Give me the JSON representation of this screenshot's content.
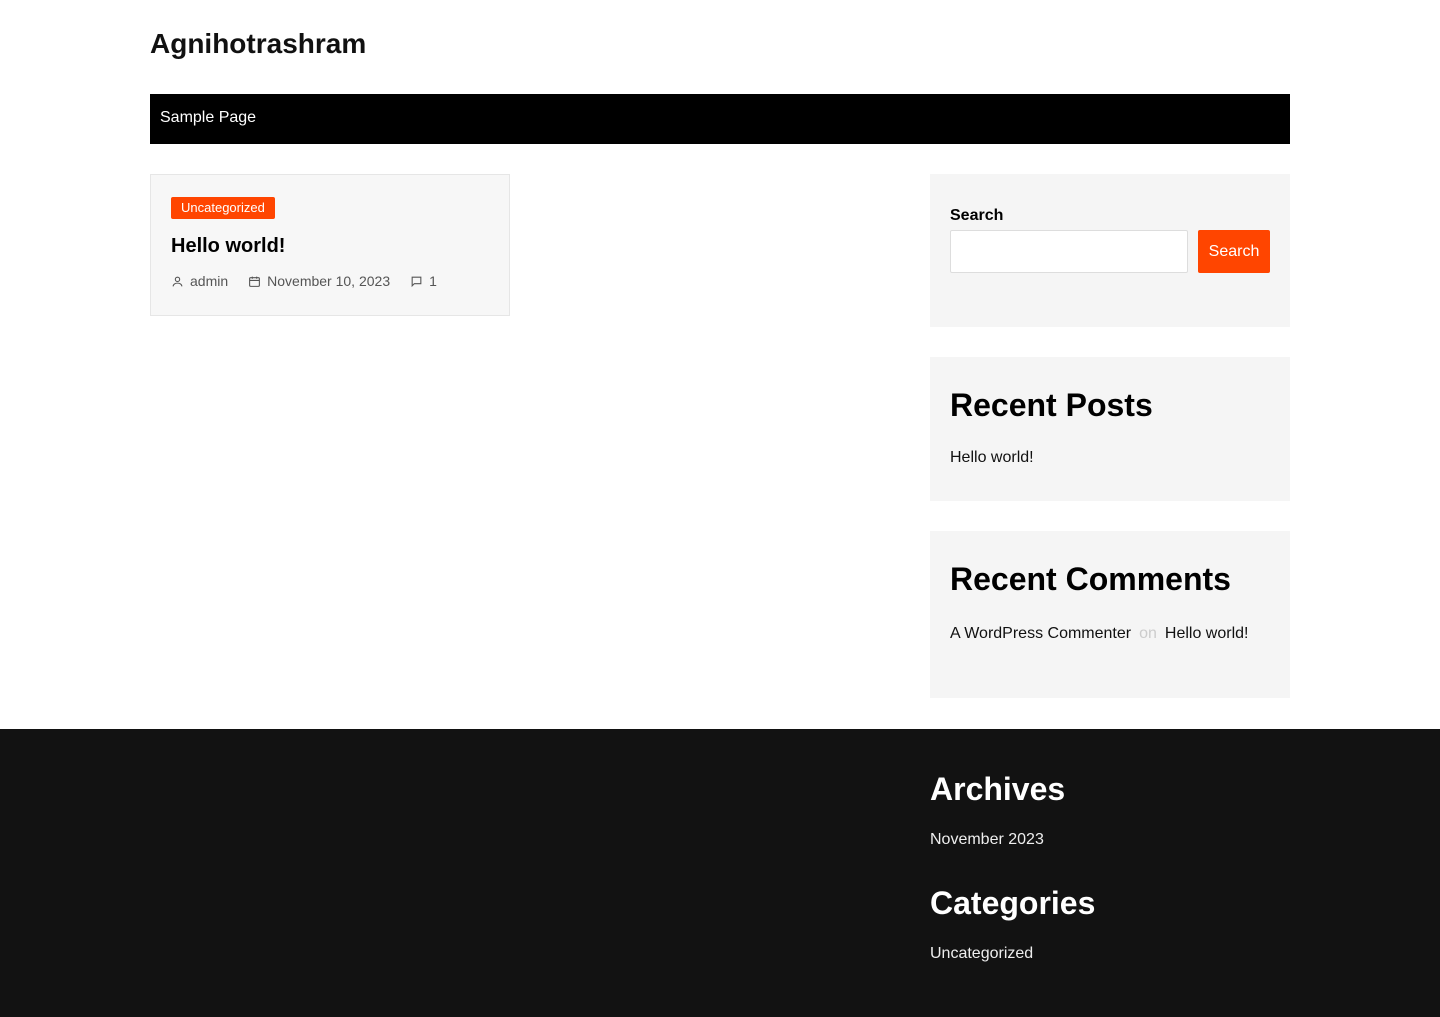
{
  "site": {
    "title": "Agnihotrashram"
  },
  "nav": {
    "items": [
      {
        "label": "Sample Page"
      }
    ]
  },
  "post": {
    "category": "Uncategorized",
    "title": "Hello world!",
    "author": "admin",
    "date": "November 10, 2023",
    "comments": "1"
  },
  "sidebar": {
    "search": {
      "label": "Search",
      "button": "Search",
      "placeholder": ""
    },
    "recent_posts": {
      "heading": "Recent Posts",
      "items": [
        "Hello world!"
      ]
    },
    "recent_comments": {
      "heading": "Recent Comments",
      "items": [
        {
          "author": "A WordPress Commenter",
          "on": "on",
          "post": "Hello world!"
        }
      ]
    }
  },
  "footer": {
    "archives": {
      "heading": "Archives",
      "items": [
        "November 2023"
      ]
    },
    "categories": {
      "heading": "Categories",
      "items": [
        "Uncategorized"
      ]
    }
  },
  "colors": {
    "accent": "#ff4500",
    "nav_bg": "#000000",
    "footer_bg": "#121212",
    "widget_bg": "#f5f5f5"
  },
  "icons": {
    "author": "user-icon",
    "date": "calendar-icon",
    "comments": "comment-icon"
  }
}
